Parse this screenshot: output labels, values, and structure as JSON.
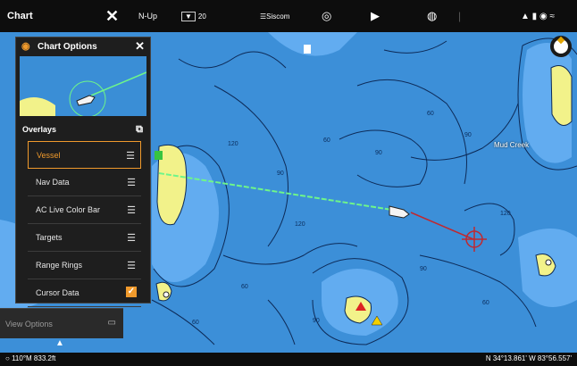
{
  "topbar": {
    "title": "Chart",
    "close_icon": "x-icon",
    "north_up": "N-Up",
    "range": "20",
    "sonar_mode": "Siscom",
    "status_icons": "▲ ▮ ◉ ≈"
  },
  "options_panel": {
    "title": "Chart Options",
    "section_label": "Overlays",
    "items": [
      {
        "label": "Vessel",
        "selected": true,
        "checked": false
      },
      {
        "label": "Nav Data",
        "selected": false,
        "checked": false
      },
      {
        "label": "AC Live Color Bar",
        "selected": false,
        "checked": false
      },
      {
        "label": "Targets",
        "selected": false,
        "checked": false
      },
      {
        "label": "Range Rings",
        "selected": false,
        "checked": false
      },
      {
        "label": "Cursor Data",
        "selected": false,
        "checked": true
      }
    ],
    "view_options_label": "View Options"
  },
  "map": {
    "place_label": "Mud Creek",
    "depth_labels": [
      "120",
      "90",
      "60",
      "90",
      "120",
      "60",
      "90",
      "60",
      "90",
      "120",
      "60",
      "90",
      "60"
    ]
  },
  "bottombar": {
    "heading": "110°M  833.2ft",
    "coordinates": "N 34°13.861' W 83°56.557'"
  },
  "colors": {
    "accent": "#f09a2c",
    "water": "#3c8fd8",
    "land": "#f2f28a",
    "panel_bg": "#1e1e1e"
  }
}
